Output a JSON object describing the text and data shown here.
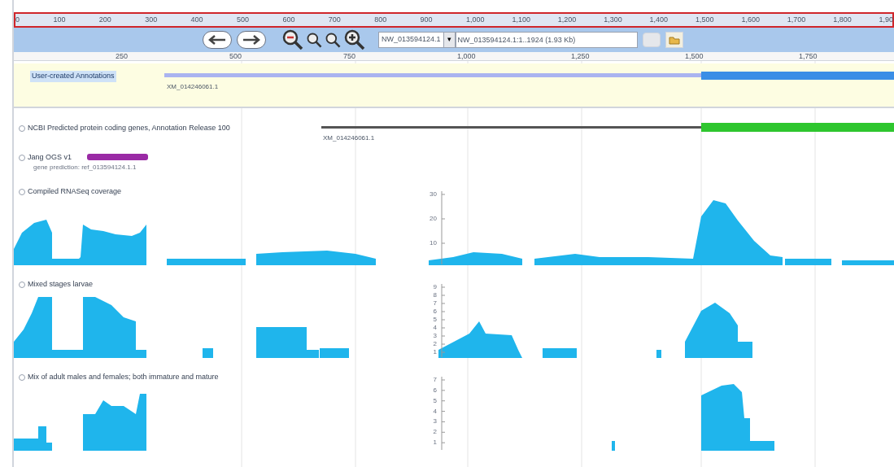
{
  "top_ruler": {
    "ticks": [
      "0",
      "100",
      "200",
      "300",
      "400",
      "500",
      "600",
      "700",
      "800",
      "900",
      "1,000",
      "1,100",
      "1,200",
      "1,300",
      "1,400",
      "1,500",
      "1,600",
      "1,700",
      "1,800",
      "1,90"
    ]
  },
  "toolbar": {
    "sequence_select": "NW_013594124.1",
    "dropdown_button": "▾",
    "range_field": "NW_013594124.1:1..1924 (1.93 Kb)"
  },
  "sequence_ruler": {
    "ticks": [
      "250",
      "500",
      "750",
      "1,000",
      "1,250",
      "1,500",
      "1,750"
    ]
  },
  "tracks": [
    {
      "kind": "annotation",
      "title": "User-created Annotations",
      "feature_label": "XM_014246061.1"
    },
    {
      "kind": "gene",
      "checked": false,
      "title": "NCBI Predicted protein coding genes, Annotation Release 100",
      "feature_label": "XM_014246061.1"
    },
    {
      "kind": "prediction",
      "checked": false,
      "title": "Jang OGS v1",
      "subtitle": "gene prediction: ref_013594124.1.1"
    },
    {
      "kind": "coverage",
      "checked": false,
      "title": "Compiled RNASeq coverage",
      "axis_labels": [
        "30",
        "20",
        "10"
      ]
    },
    {
      "kind": "coverage",
      "checked": false,
      "title": "Mixed stages larvae",
      "axis_labels": [
        "9",
        "8",
        "7",
        "6",
        "5",
        "4",
        "3",
        "2",
        "1"
      ]
    },
    {
      "kind": "coverage",
      "checked": false,
      "title": "Mix of adult males and females; both immature and mature",
      "axis_labels": [
        "7",
        "6",
        "5",
        "4",
        "3",
        "2",
        "1"
      ]
    }
  ]
}
